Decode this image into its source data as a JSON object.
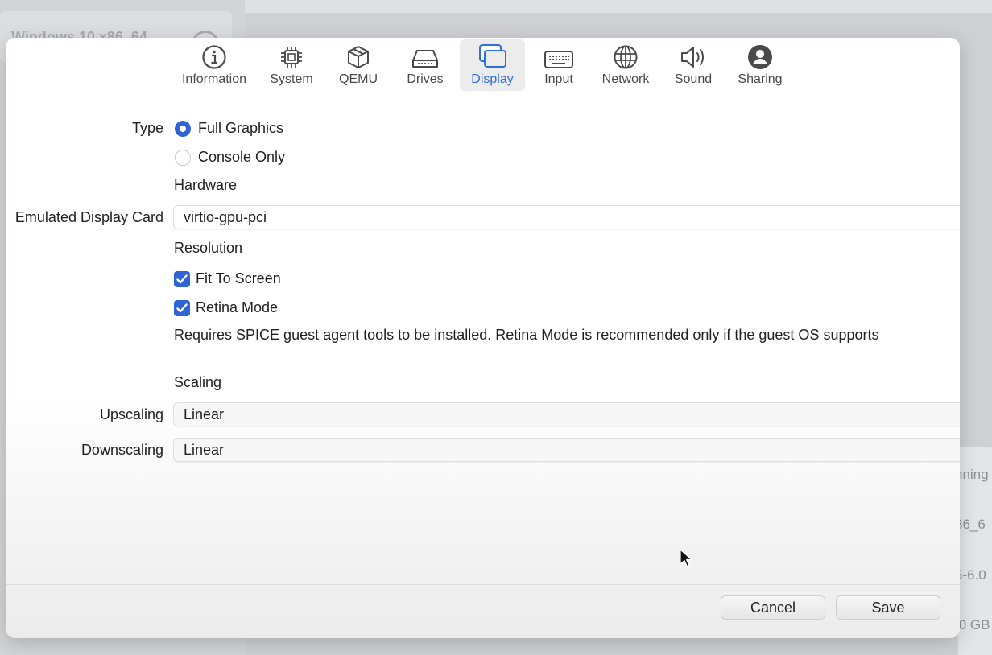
{
  "background": {
    "vm_title": "Windows 10 x86_64",
    "status_fragment": "nning",
    "arch_fragment": "86_6",
    "machine_fragment": "5-6.0",
    "size_fragment": ".0 GB"
  },
  "toolbar": {
    "tabs": [
      {
        "label": "Information",
        "icon": "info-icon"
      },
      {
        "label": "System",
        "icon": "chip-icon"
      },
      {
        "label": "QEMU",
        "icon": "cube-icon"
      },
      {
        "label": "Drives",
        "icon": "drive-icon"
      },
      {
        "label": "Display",
        "icon": "display-icon",
        "active": true
      },
      {
        "label": "Input",
        "icon": "keyboard-icon"
      },
      {
        "label": "Network",
        "icon": "globe-icon"
      },
      {
        "label": "Sound",
        "icon": "speaker-icon"
      },
      {
        "label": "Sharing",
        "icon": "person-icon"
      }
    ],
    "active_color": "#2f6fde"
  },
  "display": {
    "type_label": "Type",
    "type_options": [
      "Full Graphics",
      "Console Only"
    ],
    "type_selected": "Full Graphics",
    "hardware_heading": "Hardware",
    "emulated_card_label": "Emulated Display Card",
    "emulated_card_value": "virtio-gpu-pci",
    "resolution_heading": "Resolution",
    "fit_to_screen_label": "Fit To Screen",
    "fit_to_screen_checked": true,
    "retina_mode_label": "Retina Mode",
    "retina_mode_checked": true,
    "retina_note": "Requires SPICE guest agent tools to be installed. Retina Mode is recommended only if the guest OS supports",
    "scaling_heading": "Scaling",
    "upscaling_label": "Upscaling",
    "upscaling_value": "Linear",
    "downscaling_label": "Downscaling",
    "downscaling_value": "Linear"
  },
  "footer": {
    "cancel_label": "Cancel",
    "save_label": "Save"
  },
  "colors": {
    "accent": "#2f63d6"
  }
}
